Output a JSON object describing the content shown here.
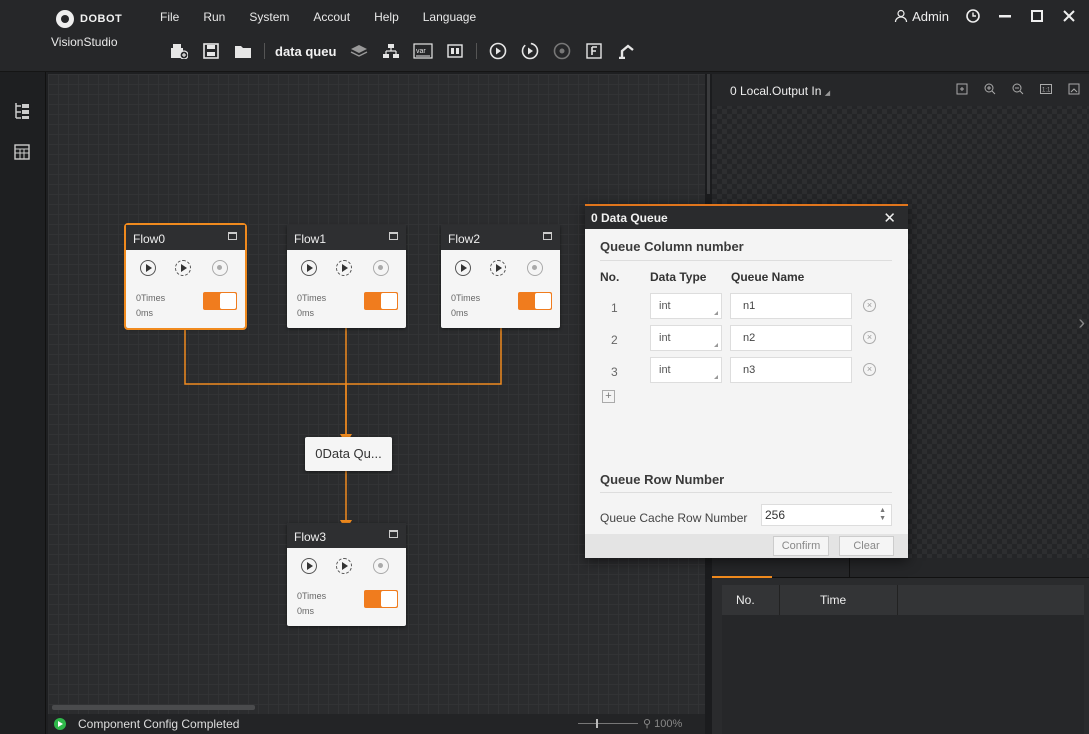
{
  "app": {
    "brand": "DOBOT",
    "product": "VisionStudio"
  },
  "menu": [
    "File",
    "Run",
    "System",
    "Accout",
    "Help",
    "Language"
  ],
  "toolbar": {
    "solution_name": "data queu"
  },
  "user": {
    "name": "Admin"
  },
  "canvas": {
    "flows": [
      {
        "name": "Flow0",
        "times": "0Times",
        "ms": "0ms"
      },
      {
        "name": "Flow1",
        "times": "0Times",
        "ms": "0ms"
      },
      {
        "name": "Flow2",
        "times": "0Times",
        "ms": "0ms"
      },
      {
        "name": "Flow3",
        "times": "0Times",
        "ms": "0ms"
      }
    ],
    "data_queue_node": "0Data Qu..."
  },
  "status": {
    "message": "Component Config Completed",
    "zoom": "100%"
  },
  "preview": {
    "title": "0 Local.Output In"
  },
  "bottom_table": {
    "headers": [
      "No.",
      "Time"
    ]
  },
  "dialog": {
    "title": "0 Data Queue",
    "section_columns": "Queue Column number",
    "col_no": "No.",
    "col_type": "Data Type",
    "col_name": "Queue Name",
    "rows": [
      {
        "no": "1",
        "type": "int",
        "name": "n1"
      },
      {
        "no": "2",
        "type": "int",
        "name": "n2"
      },
      {
        "no": "3",
        "type": "int",
        "name": "n3"
      }
    ],
    "section_rows": "Queue Row Number",
    "cache_label": "Queue Cache Row Number",
    "cache_value": "256",
    "confirm": "Confirm",
    "clear": "Clear"
  },
  "colors": {
    "accent": "#f08a1e",
    "status_ok": "#2fb84a"
  }
}
